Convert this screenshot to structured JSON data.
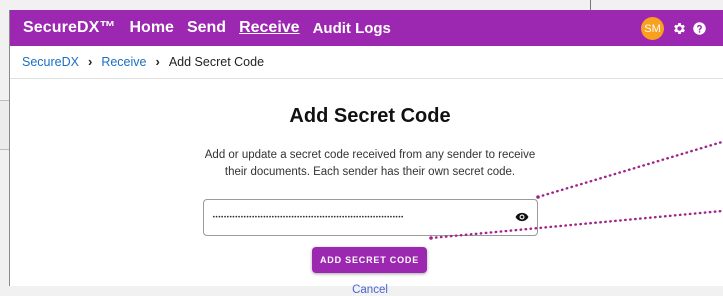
{
  "app": {
    "brand": "SecureDX™",
    "nav": [
      {
        "label": "Home",
        "active": false
      },
      {
        "label": "Send",
        "active": false
      },
      {
        "label": "Receive",
        "active": true
      },
      {
        "label": "Audit Logs",
        "active": false
      }
    ],
    "user_initials": "SM",
    "accent_color": "#9c27b0",
    "avatar_color": "#f9a01e",
    "icons": [
      "gear-icon",
      "help-icon"
    ]
  },
  "breadcrumb": {
    "items": [
      "SecureDX",
      "Receive",
      "Add Secret Code"
    ]
  },
  "page": {
    "title": "Add Secret Code",
    "description": "Add or update a secret code received from any sender to receive their documents. Each sender has their own secret code.",
    "secret_field_value": "••••••••••••••••••••••••••••••••••••••••••••••••••••••••••••••••••••",
    "add_button_label": "ADD SECRET CODE",
    "cancel_label": "Cancel"
  },
  "annotation_callouts": {
    "color": "#a0238c",
    "targets": [
      "secret-code-input",
      "add-secret-code-button"
    ]
  }
}
